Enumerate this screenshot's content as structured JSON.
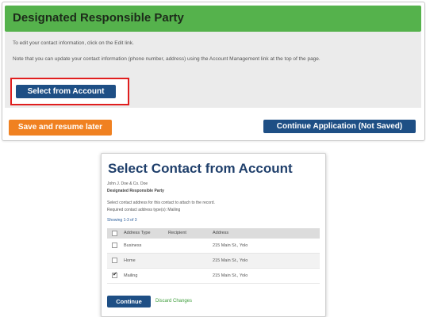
{
  "panel": {
    "title": "Designated Responsible Party",
    "intro": "To edit your contact information, click on the Edit link.",
    "note": "Note that you can update your contact information (phone number, address) using the Account Management link at the top of the page.",
    "select_button": "Select from Account",
    "save_button": "Save and resume later",
    "continue_button": "Continue Application (Not Saved)",
    "colors": {
      "header": "#55b24c",
      "primary": "#1e4f85",
      "accent": "#f08121",
      "highlight": "#e01e1e"
    }
  },
  "dialog": {
    "title": "Select Contact from Account",
    "contact_name": "John J. Doe & Co. Doe",
    "role": "Designated Responsible Party",
    "instruction": "Select contact address for this contact to attach to the record.",
    "required": "Required contact address type(s): Mailing",
    "showing": "Showing 1-3 of 3",
    "columns": [
      "Address Type",
      "Recipient",
      "Address"
    ],
    "rows": [
      {
        "type": "Business",
        "recipient": "",
        "address": "215 Main St., Yolo",
        "checked": false
      },
      {
        "type": "Home",
        "recipient": "",
        "address": "215 Main St., Yolo",
        "checked": false
      },
      {
        "type": "Mailing",
        "recipient": "",
        "address": "215 Main St., Yolo",
        "checked": true
      }
    ],
    "continue_button": "Continue",
    "discard_link": "Discard Changes"
  }
}
